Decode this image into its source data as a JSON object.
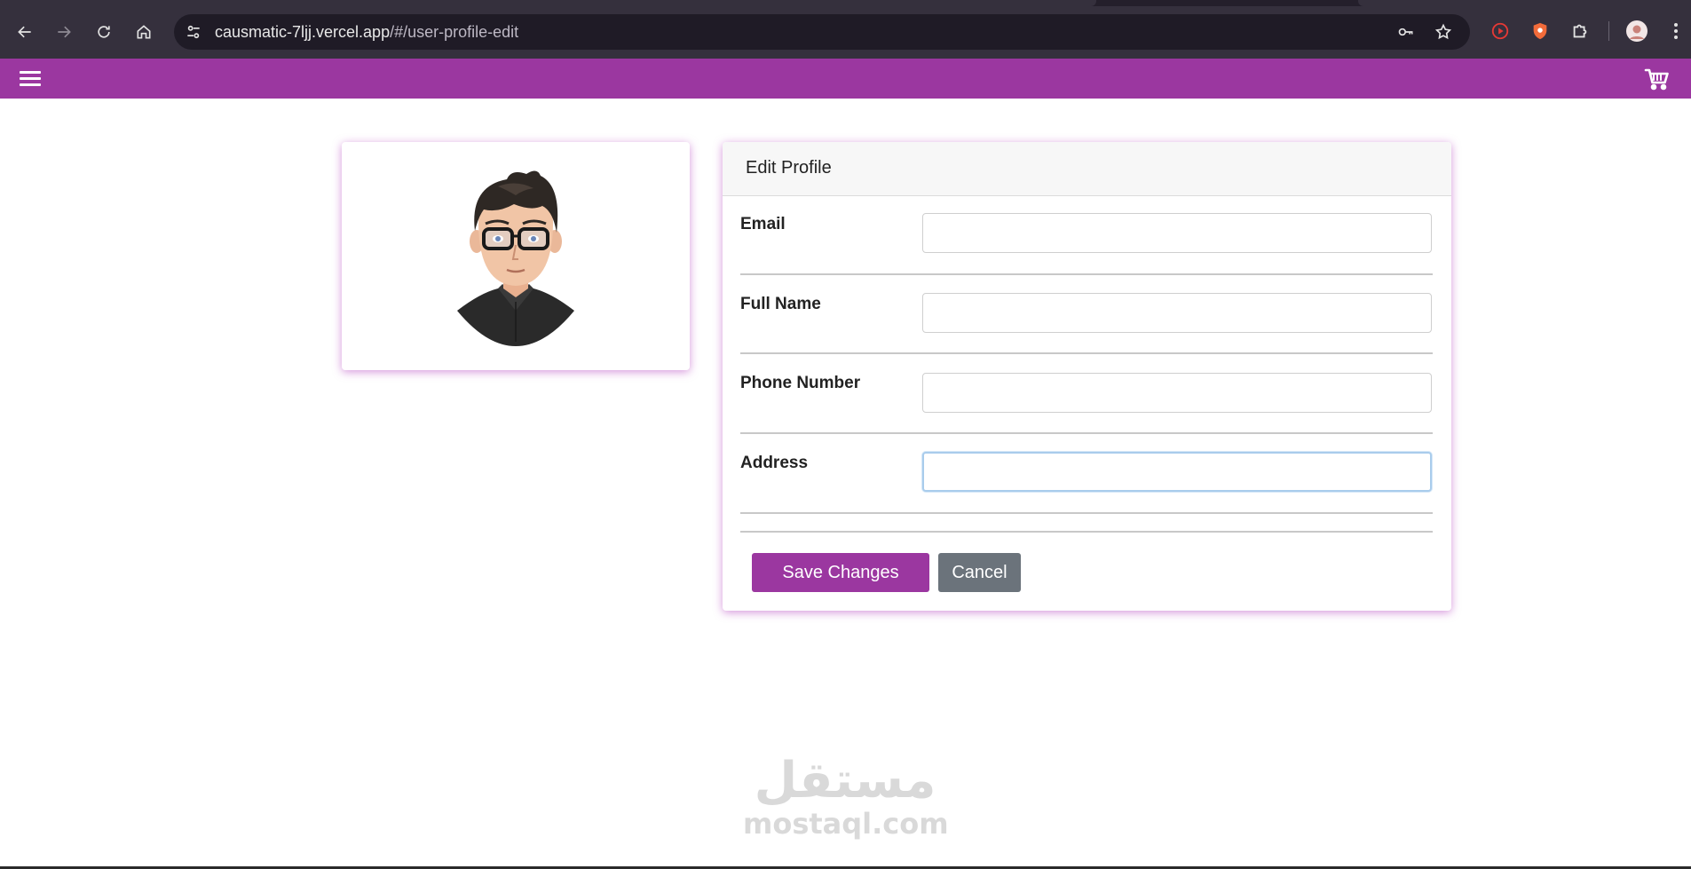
{
  "browser": {
    "url_host": "causmatic-7ljj.vercel.app",
    "url_path": "/#/user-profile-edit"
  },
  "colors": {
    "accent": "#9b37a0",
    "cancel": "#6b737b"
  },
  "card": {
    "title": "Edit Profile"
  },
  "fields": [
    {
      "label": "Email",
      "value": ""
    },
    {
      "label": "Full Name",
      "value": ""
    },
    {
      "label": "Phone Number",
      "value": ""
    },
    {
      "label": "Address",
      "value": ""
    }
  ],
  "actions": {
    "save_label": "Save Changes",
    "cancel_label": "Cancel"
  },
  "watermark": {
    "arabic": "مستقل",
    "latin": "mostaql.com"
  }
}
